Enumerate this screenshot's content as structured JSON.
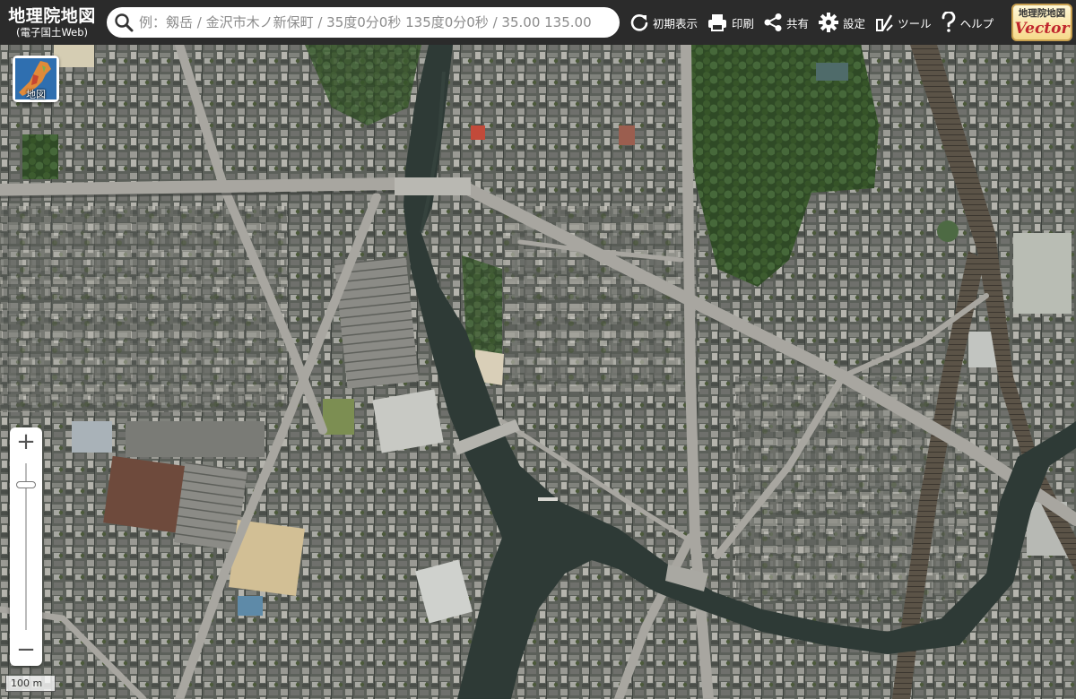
{
  "app": {
    "title": "地理院地図",
    "subtitle": "(電子国土Web)"
  },
  "search": {
    "placeholder": "例：剱岳 / 金沢市木ノ新保町 / 35度0分0秒 135度0分0秒 / 35.00 135.00"
  },
  "toolbar": {
    "home_label": "初期表示",
    "print_label": "印刷",
    "share_label": "共有",
    "settings_label": "設定",
    "tools_label": "ツール",
    "help_label": "ヘルプ"
  },
  "vector_logo": {
    "top": "地理院地図",
    "bottom": "Vector"
  },
  "layer_button": {
    "label": "地図"
  },
  "zoom": {
    "in_label": "+",
    "out_label": "−",
    "level_fraction": 0.13
  },
  "scale": {
    "label": "100 m"
  },
  "icons": {
    "search": "search-icon",
    "home": "refresh-arrow-icon",
    "print": "printer-icon",
    "share": "share-icon",
    "settings": "gear-icon",
    "tools": "tools-icon",
    "help": "question-mark-icon"
  },
  "colors": {
    "header_bg": "#2b2b2b",
    "river": "#2e3a36",
    "vector_red": "#c0262d"
  }
}
